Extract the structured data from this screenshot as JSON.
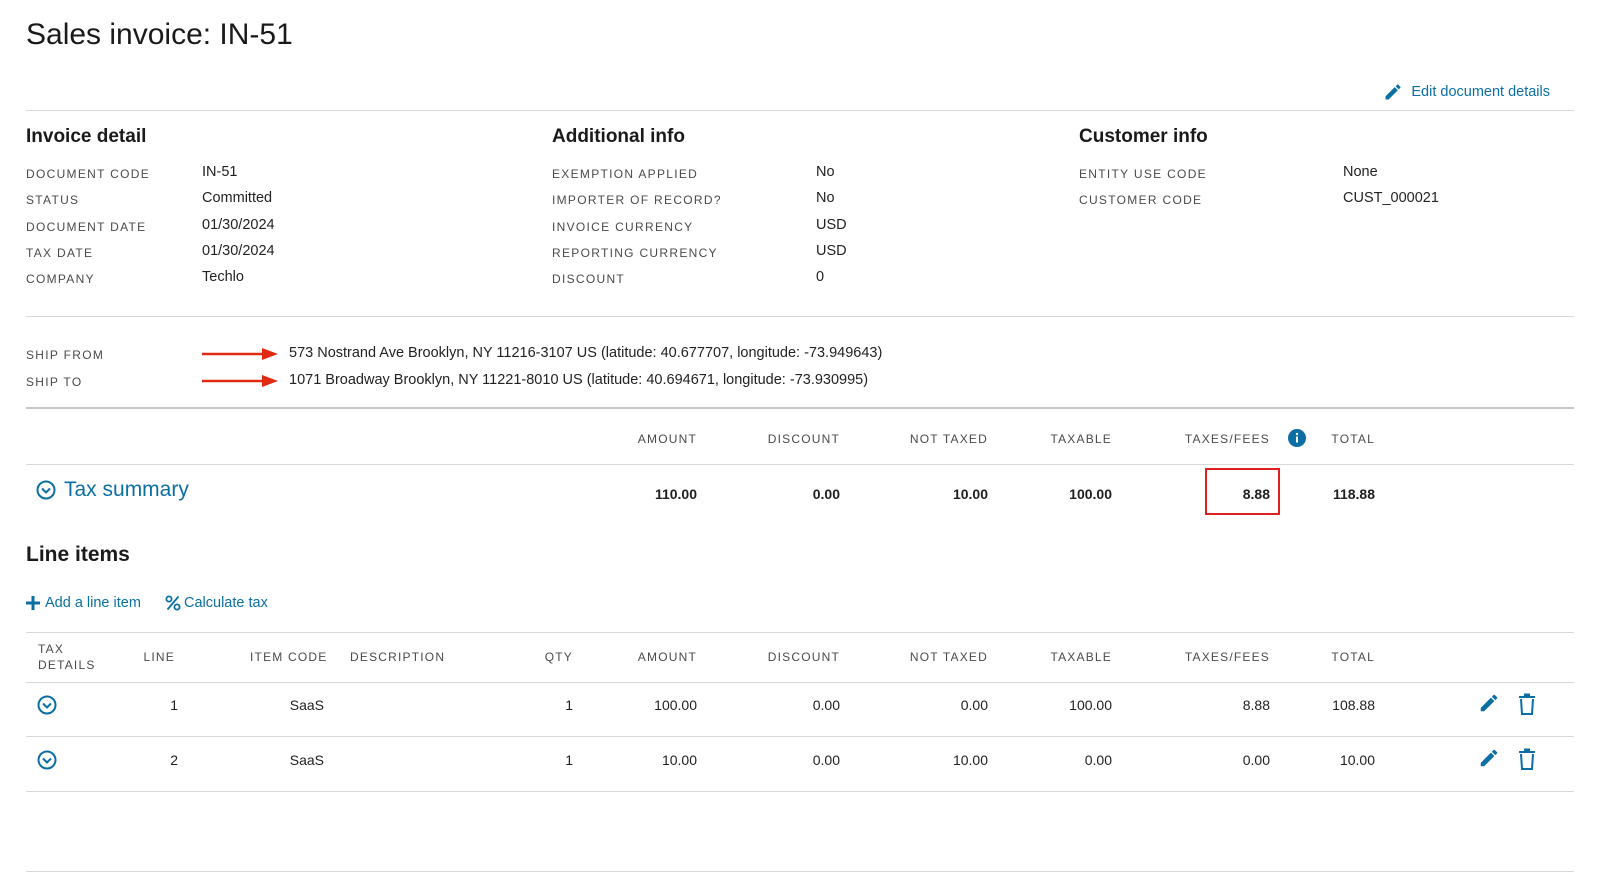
{
  "page": {
    "title": "Sales invoice: IN-51",
    "edit_label": "Edit document details"
  },
  "invoice_detail": {
    "heading": "Invoice detail",
    "rows": [
      {
        "label": "DOCUMENT CODE",
        "value": "IN-51"
      },
      {
        "label": "STATUS",
        "value": "Committed"
      },
      {
        "label": "DOCUMENT DATE",
        "value": "01/30/2024"
      },
      {
        "label": "TAX DATE",
        "value": "01/30/2024"
      },
      {
        "label": "COMPANY",
        "value": "Techlo"
      }
    ]
  },
  "additional_info": {
    "heading": "Additional info",
    "rows": [
      {
        "label": "EXEMPTION APPLIED",
        "value": "No"
      },
      {
        "label": "IMPORTER OF RECORD?",
        "value": "No"
      },
      {
        "label": "INVOICE CURRENCY",
        "value": "USD"
      },
      {
        "label": "REPORTING CURRENCY",
        "value": "USD"
      },
      {
        "label": "DISCOUNT",
        "value": "0"
      }
    ]
  },
  "customer_info": {
    "heading": "Customer info",
    "rows": [
      {
        "label": "ENTITY USE CODE",
        "value": "None"
      },
      {
        "label": "CUSTOMER CODE",
        "value": "CUST_000021"
      }
    ]
  },
  "addresses": {
    "ship_from_label": "SHIP FROM",
    "ship_from": "573 Nostrand Ave Brooklyn, NY 11216-3107 US (latitude: 40.677707, longitude: -73.949643)",
    "ship_to_label": "SHIP TO",
    "ship_to": "1071 Broadway Brooklyn, NY 11221-8010 US (latitude: 40.694671, longitude: -73.930995)"
  },
  "summary": {
    "headers": {
      "amount": "AMOUNT",
      "discount": "DISCOUNT",
      "not_taxed": "NOT TAXED",
      "taxable": "TAXABLE",
      "taxes": "TAXES/FEES",
      "total": "TOTAL"
    },
    "label": "Tax summary",
    "values": {
      "amount": "110.00",
      "discount": "0.00",
      "not_taxed": "10.00",
      "taxable": "100.00",
      "taxes": "8.88",
      "total": "118.88"
    }
  },
  "line_items": {
    "heading": "Line items",
    "add_label": "Add a line item",
    "calc_label": "Calculate tax",
    "headers": {
      "tax_details_1": "TAX",
      "tax_details_2": "DETAILS",
      "line": "LINE",
      "item_code": "ITEM CODE",
      "description": "DESCRIPTION",
      "qty": "QTY",
      "amount": "AMOUNT",
      "discount": "DISCOUNT",
      "not_taxed": "NOT TAXED",
      "taxable": "TAXABLE",
      "taxes": "TAXES/FEES",
      "total": "TOTAL"
    },
    "rows": [
      {
        "line": "1",
        "item_code": "SaaS",
        "description": "",
        "qty": "1",
        "amount": "100.00",
        "discount": "0.00",
        "not_taxed": "0.00",
        "taxable": "100.00",
        "taxes": "8.88",
        "total": "108.88"
      },
      {
        "line": "2",
        "item_code": "SaaS",
        "description": "",
        "qty": "1",
        "amount": "10.00",
        "discount": "0.00",
        "not_taxed": "10.00",
        "taxable": "0.00",
        "taxes": "0.00",
        "total": "10.00"
      }
    ]
  },
  "colors": {
    "link": "#0b6fa4",
    "annotation": "#e02020"
  },
  "icons": [
    "pencil-icon",
    "chevron-circle-icon",
    "plus-icon",
    "percent-icon",
    "info-icon",
    "trash-icon",
    "arrow-icon"
  ]
}
